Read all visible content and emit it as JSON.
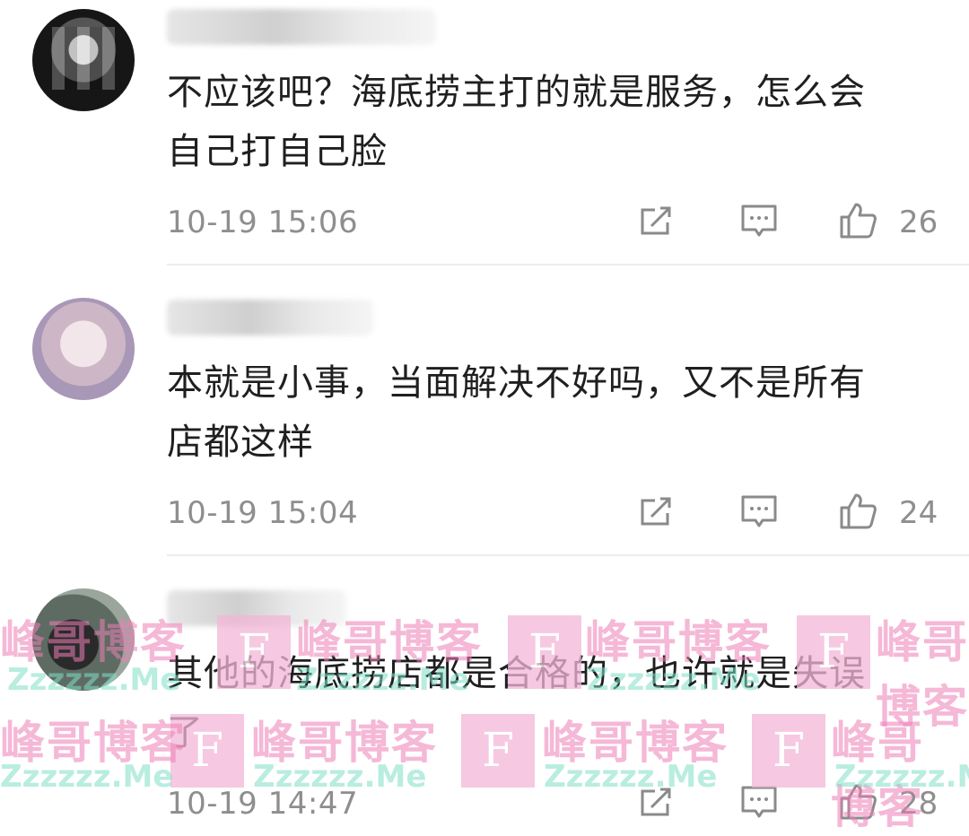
{
  "comments": [
    {
      "text_line1": "不应该吧？海底捞主打的就是服务，怎么会",
      "text_line2": "自己打自己脸",
      "time": "10-19 15:06",
      "likes": "26"
    },
    {
      "text_line1": "本就是小事，当面解决不好吗，又不是所有",
      "text_line2": "店都这样",
      "time": "10-19 15:04",
      "likes": "24"
    },
    {
      "text_line1": "其他的海底捞店都是合格的，也许就是失误",
      "text_line2": "了",
      "time": "10-19 14:47",
      "likes": "28"
    }
  ],
  "icons": {
    "share": "share-icon",
    "reply": "comment-icon",
    "like": "thumbs-up-icon"
  },
  "watermark": {
    "logo_letter": "F",
    "name_cn": "峰哥博客",
    "domain": "Zzzzzz.Me"
  },
  "colors": {
    "text": "#1f1f1f",
    "meta": "#8e8e8e",
    "divider": "#ececec",
    "watermark_pink": "#ee7fb7",
    "watermark_green": "#7fe0c8"
  }
}
